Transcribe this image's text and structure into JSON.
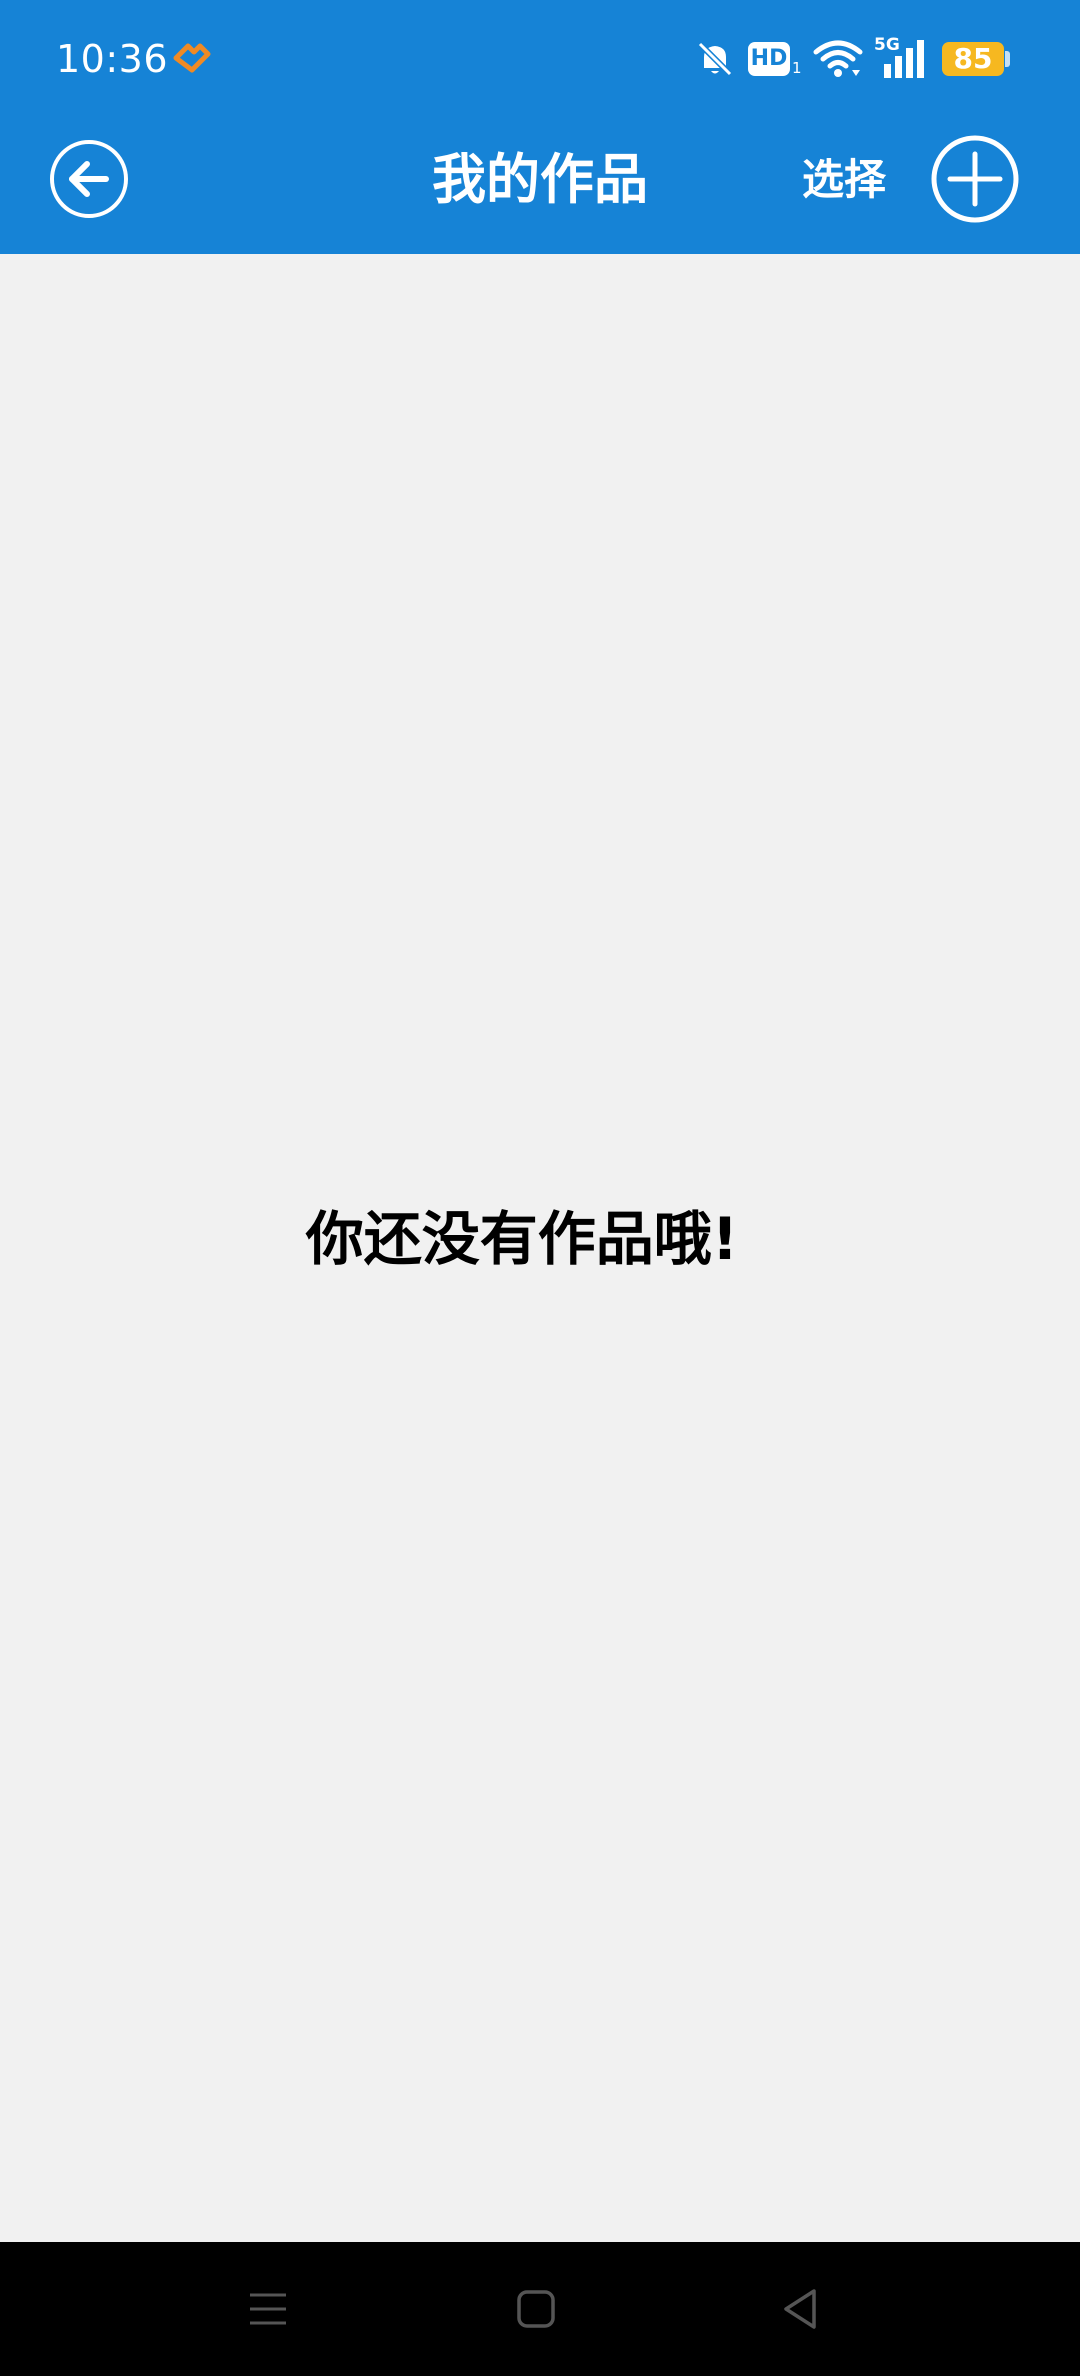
{
  "status_bar": {
    "time": "10:36",
    "hd_label": "HD",
    "hd_sub": "1",
    "network_label": "5G",
    "battery": "85",
    "icons": [
      "app-notification-icon",
      "bell-muted-icon",
      "hd-icon",
      "wifi-icon",
      "signal-icon",
      "battery-icon"
    ]
  },
  "header": {
    "title": "我的作品",
    "select_label": "选择",
    "back_icon": "arrow-left-circle-icon",
    "add_icon": "plus-circle-icon"
  },
  "main": {
    "empty_message": "你还没有作品哦!"
  },
  "nav_bar": {
    "icons": [
      "menu-icon",
      "home-icon",
      "back-triangle-icon"
    ]
  },
  "colors": {
    "primary": "#1683d6",
    "background": "#f1f1f1",
    "battery": "#f6b820",
    "app_icon": "#f08a24"
  }
}
